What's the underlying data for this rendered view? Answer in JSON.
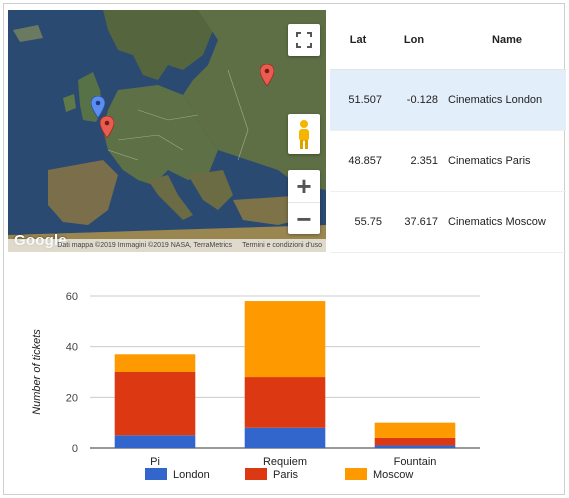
{
  "map": {
    "logo": "Google",
    "attribution": "Dati mappa ©2019 Immagini ©2019 NASA, TerraMetrics",
    "terms": "Termini e condizioni d'uso",
    "zoom_in": "+",
    "zoom_out": "−",
    "colors": {
      "sea": "#2b4a72",
      "land": "#5a6b45",
      "marker_red": "#e85d4f",
      "marker_blue": "#5b8ef0"
    },
    "controls": [
      "fullscreen-icon",
      "pegman-icon"
    ]
  },
  "table": {
    "headers": {
      "lat": "Lat",
      "lon": "Lon",
      "name": "Name"
    },
    "rows": [
      {
        "lat": "51.507",
        "lon": "-0.128",
        "name": "Cinematics London",
        "selected": true
      },
      {
        "lat": "48.857",
        "lon": "2.351",
        "name": "Cinematics Paris",
        "selected": false
      },
      {
        "lat": "55.75",
        "lon": "37.617",
        "name": "Cinematics Moscow",
        "selected": false
      }
    ]
  },
  "chart_data": {
    "type": "bar",
    "stacked": true,
    "title": "",
    "xlabel": "",
    "ylabel": "Number of tickets",
    "categories": [
      "Pi",
      "Requiem",
      "Fountain"
    ],
    "ylim": [
      0,
      60
    ],
    "yticks": [
      "0",
      "20",
      "40",
      "60"
    ],
    "grid": true,
    "legend_position": "bottom",
    "series": [
      {
        "name": "London",
        "color": "#3366cc",
        "values": [
          5,
          8,
          1
        ]
      },
      {
        "name": "Paris",
        "color": "#dc3912",
        "values": [
          25,
          20,
          3
        ]
      },
      {
        "name": "Moscow",
        "color": "#ff9900",
        "values": [
          7,
          30,
          6
        ]
      }
    ]
  }
}
